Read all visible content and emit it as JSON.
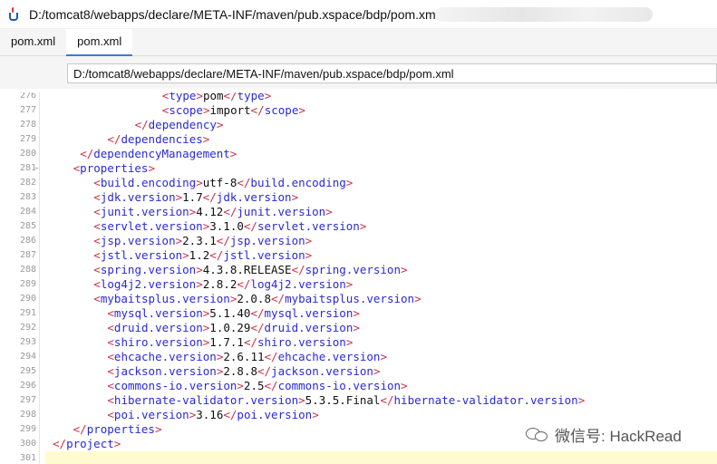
{
  "window": {
    "title": "D:/tomcat8/webapps/declare/META-INF/maven/pub.xspace/bdp/pom.xml"
  },
  "tabs": [
    {
      "label": "pom.xml",
      "active": false
    },
    {
      "label": "pom.xml",
      "active": true
    }
  ],
  "path_bar": {
    "value": "D:/tomcat8/webapps/declare/META-INF/maven/pub.xspace/bdp/pom.xml"
  },
  "overflow_dots": "···",
  "editor": {
    "lines": [
      {
        "num": "276",
        "indent": 16,
        "open": "type",
        "text": "pom",
        "close": "type"
      },
      {
        "num": "277",
        "indent": 16,
        "open": "scope",
        "text": "import",
        "close": "scope"
      },
      {
        "num": "278",
        "indent": 12,
        "close": "dependency"
      },
      {
        "num": "279",
        "indent": 8,
        "close": "dependencies"
      },
      {
        "num": "280",
        "indent": 4,
        "close": "dependencyManagement"
      },
      {
        "num": "281",
        "indent": 3,
        "open": "properties",
        "fold": "−"
      },
      {
        "num": "282",
        "indent": 6,
        "open": "build.encoding",
        "text": "utf-8",
        "close": "build.encoding"
      },
      {
        "num": "283",
        "indent": 6,
        "open": "jdk.version",
        "text": "1.7",
        "close": "jdk.version"
      },
      {
        "num": "284",
        "indent": 6,
        "open": "junit.version",
        "text": "4.12",
        "close": "junit.version"
      },
      {
        "num": "285",
        "indent": 6,
        "open": "servlet.version",
        "text": "3.1.0",
        "close": "servlet.version"
      },
      {
        "num": "286",
        "indent": 6,
        "open": "jsp.version",
        "text": "2.3.1",
        "close": "jsp.version"
      },
      {
        "num": "287",
        "indent": 6,
        "open": "jstl.version",
        "text": "1.2",
        "close": "jstl.version"
      },
      {
        "num": "288",
        "indent": 6,
        "open": "spring.version",
        "text": "4.3.8.RELEASE",
        "close": "spring.version"
      },
      {
        "num": "289",
        "indent": 6,
        "open": "log4j2.version",
        "text": "2.8.2",
        "close": "log4j2.version"
      },
      {
        "num": "290",
        "indent": 6,
        "open": "mybaitsplus.version",
        "text": "2.0.8",
        "close": "mybaitsplus.version"
      },
      {
        "num": "291",
        "indent": 8,
        "open": "mysql.version",
        "text": "5.1.40",
        "close": "mysql.version"
      },
      {
        "num": "292",
        "indent": 8,
        "open": "druid.version",
        "text": "1.0.29",
        "close": "druid.version"
      },
      {
        "num": "293",
        "indent": 8,
        "open": "shiro.version",
        "text": "1.7.1",
        "close": "shiro.version"
      },
      {
        "num": "294",
        "indent": 8,
        "open": "ehcache.version",
        "text": "2.6.11",
        "close": "ehcache.version"
      },
      {
        "num": "295",
        "indent": 8,
        "open": "jackson.version",
        "text": "2.8.8",
        "close": "jackson.version"
      },
      {
        "num": "296",
        "indent": 8,
        "open": "commons-io.version",
        "text": "2.5",
        "close": "commons-io.version"
      },
      {
        "num": "297",
        "indent": 8,
        "open": "hibernate-validator.version",
        "text": "5.3.5.Final",
        "close": "hibernate-validator.version"
      },
      {
        "num": "298",
        "indent": 8,
        "open": "poi.version",
        "text": "3.16",
        "close": "poi.version"
      },
      {
        "num": "299",
        "indent": 3,
        "close": "properties"
      },
      {
        "num": "300",
        "indent": 0,
        "close": "project"
      },
      {
        "num": "301",
        "indent": 0,
        "highlight": true
      }
    ]
  },
  "watermark": {
    "text": "微信号: HackRead"
  },
  "colors": {
    "tag": "#2a2ad6",
    "bracket": "#c8324a",
    "text": "#111111",
    "current_line": "#fffbd0",
    "tab_accent": "#3a7bd5"
  }
}
